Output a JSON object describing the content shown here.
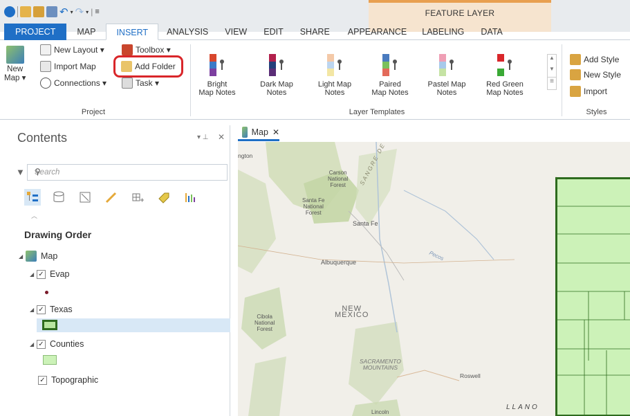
{
  "quick_access": {
    "undo_symbol": "↶",
    "redo_symbol": "↷",
    "customize_symbol": "≡"
  },
  "context_tab_group": "FEATURE LAYER",
  "tabs": [
    "PROJECT",
    "MAP",
    "INSERT",
    "ANALYSIS",
    "VIEW",
    "EDIT",
    "SHARE",
    "APPEARANCE",
    "LABELING",
    "DATA"
  ],
  "active_tab": "INSERT",
  "ribbon": {
    "project_group": {
      "label": "Project",
      "new_map": "New",
      "new_map_sub": "Map ▾",
      "new_layout": "New Layout ▾",
      "toolbox": "Toolbox ▾",
      "import_map": "Import Map",
      "add_folder": "Add Folder",
      "connections": "Connections ▾",
      "task": "Task ▾"
    },
    "layer_templates_group": {
      "label": "Layer Templates",
      "items": [
        {
          "line1": "Bright",
          "line2": "Map Notes",
          "colors": [
            "#d8462d",
            "#3c7ac7",
            "#7d3fa0"
          ]
        },
        {
          "line1": "Dark Map",
          "line2": "Notes",
          "colors": [
            "#b2204c",
            "#243f7a",
            "#5a2d76"
          ]
        },
        {
          "line1": "Light Map",
          "line2": "Notes",
          "colors": [
            "#f4c9a8",
            "#bcd5ef",
            "#f3e6a4"
          ]
        },
        {
          "line1": "Paired",
          "line2": "Map Notes",
          "colors": [
            "#4a7bbf",
            "#7ac05c",
            "#e36a5a"
          ]
        },
        {
          "line1": "Pastel Map",
          "line2": "Notes",
          "colors": [
            "#ef9fb5",
            "#a7c9ea",
            "#c5e3a4"
          ]
        },
        {
          "line1": "Red Green",
          "line2": "Map Notes",
          "colors": [
            "#d9262a",
            "#ffffff",
            "#3aa935"
          ]
        }
      ]
    },
    "styles_group": {
      "label": "Styles",
      "add_style": "Add Style",
      "new_style": "New Style",
      "import": "Import"
    }
  },
  "contents": {
    "title": "Contents",
    "pin_symbol": "▾ \u0018",
    "close_symbol": "✕",
    "search_placeholder": "Search",
    "drawing_order": "Drawing Order",
    "layers": [
      {
        "name": "Map"
      },
      {
        "name": "Evap"
      },
      {
        "name": "Texas"
      },
      {
        "name": "Counties"
      },
      {
        "name": "Topographic"
      }
    ]
  },
  "map_view": {
    "tab_label": "Map",
    "labels": {
      "carson": "Carson\nNational\nForest",
      "santa_fe_nf": "Santa Fe\nNational\nForest",
      "santa_fe": "Santa Fe",
      "sangre": "SANGRE DE CRISTO",
      "albuquerque": "Albuquerque",
      "pecos": "Pecos",
      "new_mexico": "NEW\nMEXICO",
      "cibola": "Cibola\nNational\nForest",
      "sacramento": "SACRAMENTO\nMOUNTAINS",
      "roswell": "Roswell",
      "llano": "LLANO",
      "lincoln": "Lincoln",
      "top_left": "ngton"
    },
    "texas_fill": "#ccf2b8",
    "texas_outline": "#2e6b1e"
  },
  "colors": {
    "accent": "#1f6fc6",
    "highlight": "#d9262a",
    "selection": "#d8e8f6"
  }
}
